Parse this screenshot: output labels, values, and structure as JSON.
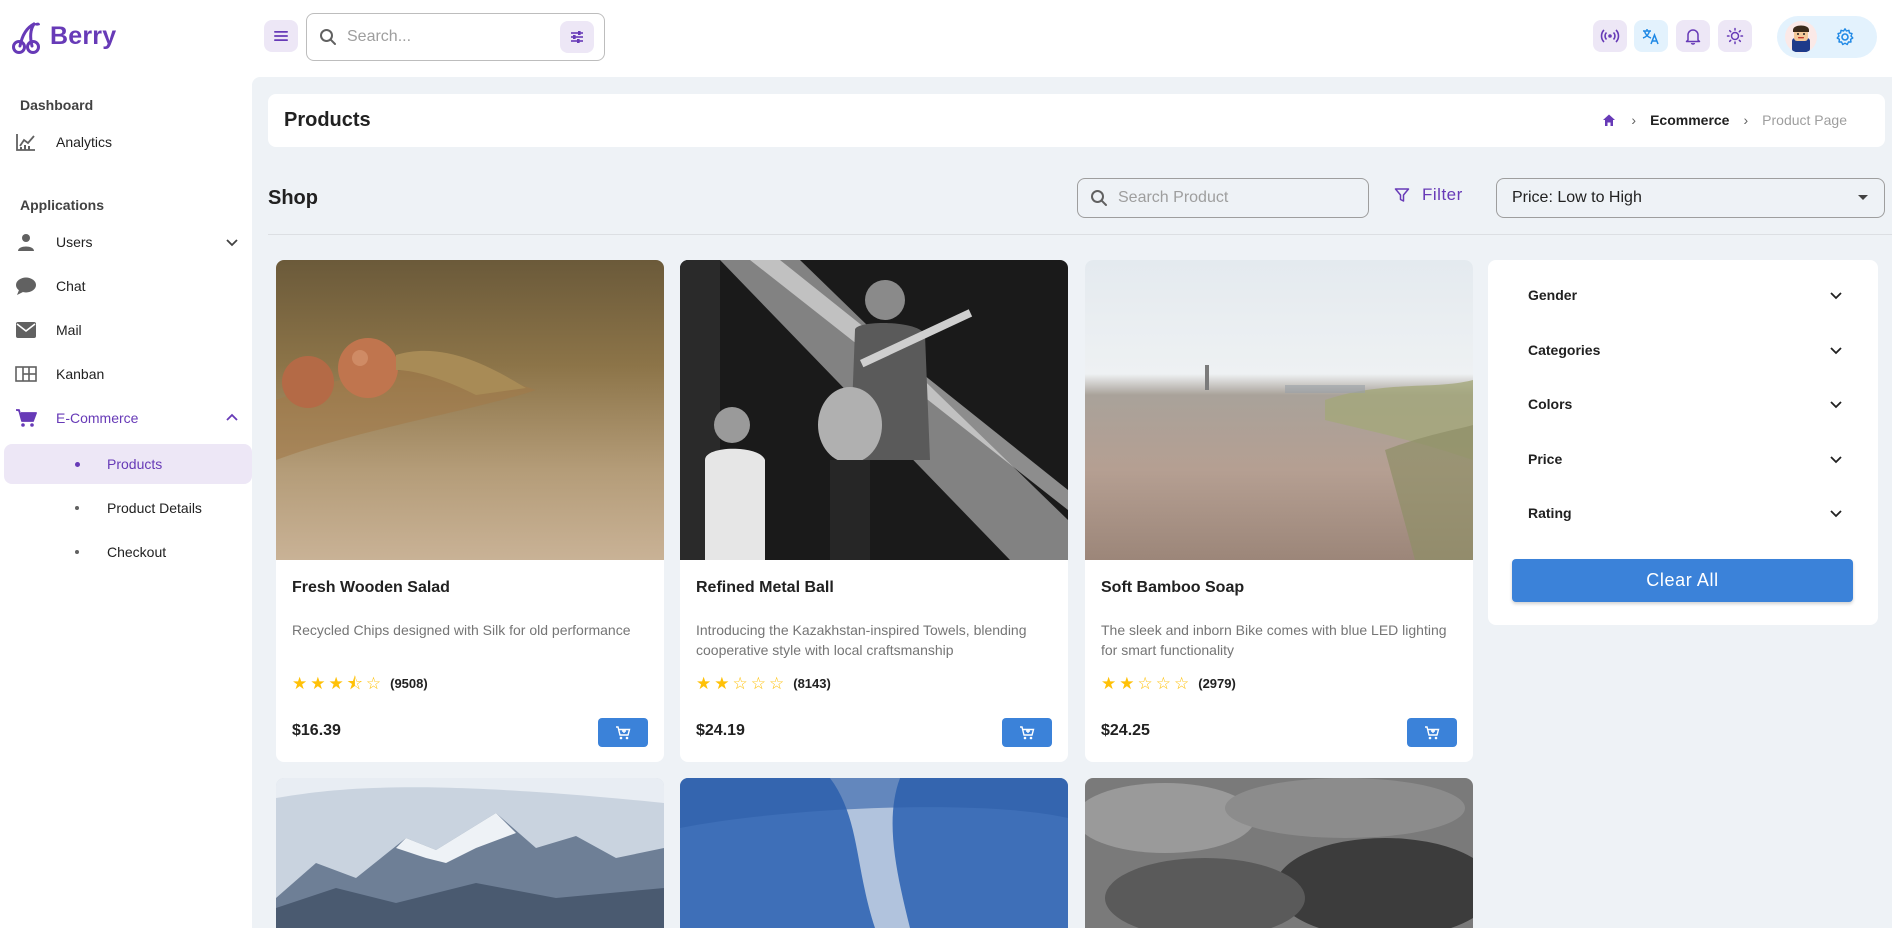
{
  "brand": {
    "name": "Berry",
    "accent": "#673ab7",
    "primary_button": "#3b82d9"
  },
  "header": {
    "search_placeholder": "Search...",
    "icons": [
      "broadcast-icon",
      "translate-icon",
      "bell-icon",
      "sun-icon",
      "settings-icon"
    ]
  },
  "sidebar": {
    "sections": [
      {
        "caption": "Dashboard"
      },
      {
        "caption": "Applications"
      }
    ],
    "items": [
      {
        "label": "Analytics",
        "icon": "analytics-icon"
      },
      {
        "label": "Users",
        "icon": "user-icon"
      },
      {
        "label": "Chat",
        "icon": "chat-icon"
      },
      {
        "label": "Mail",
        "icon": "mail-icon"
      },
      {
        "label": "Kanban",
        "icon": "kanban-icon"
      },
      {
        "label": "E-Commerce",
        "icon": "cart-icon"
      }
    ],
    "ecommerce_children": [
      {
        "label": "Products",
        "selected": true
      },
      {
        "label": "Product Details"
      },
      {
        "label": "Checkout"
      }
    ]
  },
  "breadcrumb": {
    "title": "Products",
    "trail": [
      "Ecommerce",
      "Product Page"
    ]
  },
  "shop": {
    "title": "Shop",
    "search_placeholder": "Search Product",
    "filter_label": "Filter",
    "sort_value": "Price: Low to High"
  },
  "products": [
    {
      "name": "Fresh Wooden Salad",
      "description": "Recycled Chips designed with Silk for old performance",
      "rating": 3.5,
      "reviews": "(9508)",
      "price": "$16.39"
    },
    {
      "name": "Refined Metal Ball",
      "description": "Introducing the Kazakhstan-inspired Towels, blending cooperative style with local craftsmanship",
      "rating": 2,
      "reviews": "(8143)",
      "price": "$24.19"
    },
    {
      "name": "Soft Bamboo Soap",
      "description": "The sleek and inborn Bike comes with blue LED lighting for smart functionality",
      "rating": 2,
      "reviews": "(2979)",
      "price": "$24.25"
    }
  ],
  "filters": {
    "sections": [
      "Gender",
      "Categories",
      "Colors",
      "Price",
      "Rating"
    ],
    "clear_label": "Clear All"
  }
}
